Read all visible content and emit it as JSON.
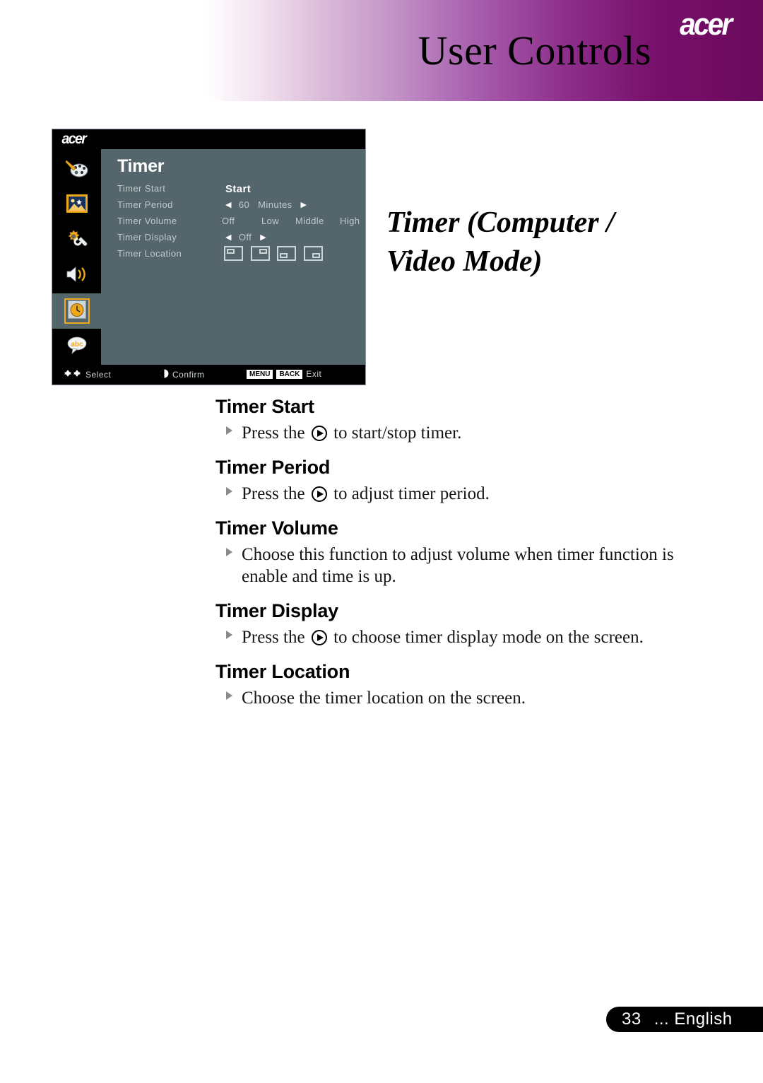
{
  "header": {
    "title": "User Controls",
    "brand": "acer"
  },
  "doc_title": "Timer (Computer / Video Mode)",
  "osd": {
    "brand": "acer",
    "menu_title": "Timer",
    "sidebar": [
      {
        "name": "color-palette-icon",
        "label": "Color",
        "selected": false
      },
      {
        "name": "image-icon",
        "label": "Image",
        "selected": false
      },
      {
        "name": "settings-gear-wrench-icon",
        "label": "Setting",
        "selected": false
      },
      {
        "name": "speaker-volume-icon",
        "label": "Audio",
        "selected": false
      },
      {
        "name": "clock-timer-icon",
        "label": "Timer",
        "selected": true
      },
      {
        "name": "language-abc-bubble-icon",
        "label": "Language",
        "selected": false
      }
    ],
    "rows": [
      {
        "label": "Timer Start",
        "value": "Start"
      },
      {
        "label": "Timer Period",
        "value": "60",
        "unit": "Minutes",
        "left_arrow": "◀",
        "right_arrow": "▶"
      },
      {
        "label": "Timer Volume",
        "options": [
          "Off",
          "Low",
          "Middle",
          "High"
        ]
      },
      {
        "label": "Timer Display",
        "value": "Off",
        "left_arrow": "◀",
        "right_arrow": "▶"
      },
      {
        "label": "Timer Location",
        "locations": [
          "top-left",
          "top-right",
          "bottom-left",
          "bottom-right"
        ]
      }
    ],
    "bottombar": {
      "select_label": "Select",
      "confirm_label": "Confirm",
      "menu_key": "MENU",
      "back_key": "BACK",
      "exit_label": "Exit"
    }
  },
  "sections": [
    {
      "heading": "Timer Start",
      "text_before": "Press the",
      "text_after": "to start/stop timer.",
      "has_play_icon": true
    },
    {
      "heading": "Timer Period",
      "text_before": "Press the",
      "text_after": "to adjust timer period.",
      "has_play_icon": true
    },
    {
      "heading": "Timer Volume",
      "text_before": "Choose this function to adjust volume when timer function is enable and time is up.",
      "text_after": "",
      "has_play_icon": false
    },
    {
      "heading": "Timer Display",
      "text_before": "Press the",
      "text_after": "to choose timer display mode on the screen.",
      "has_play_icon": true
    },
    {
      "heading": "Timer Location",
      "text_before": "Choose the timer location on the screen.",
      "text_after": "",
      "has_play_icon": false
    }
  ],
  "footer": {
    "page_number": "33",
    "language": "... English"
  },
  "colors": {
    "header_gradient_end": "#6b0a5c",
    "osd_panel": "#54656b",
    "osd_black": "#000000",
    "selection_orange": "#f0a81e",
    "osd_label": "#c0cacd"
  }
}
